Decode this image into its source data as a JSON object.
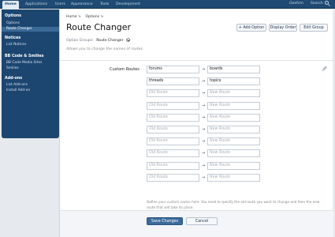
{
  "nav": {
    "tabs": [
      {
        "label": "Home",
        "active": true
      },
      {
        "label": "Applications"
      },
      {
        "label": "Users"
      },
      {
        "label": "Appearance"
      },
      {
        "label": "Tools"
      },
      {
        "label": "Development"
      }
    ],
    "user": "Geefcm",
    "search_label": "Search"
  },
  "sidebar": {
    "sections": [
      {
        "heading": "Options",
        "items": [
          "Options",
          "Route Changer"
        ]
      },
      {
        "heading": "Notices",
        "items": [
          "List Notices"
        ]
      },
      {
        "heading": "BB Code & Smilies",
        "items": [
          "BB Code Media Sites",
          "Smilies"
        ]
      },
      {
        "heading": "Add-ons",
        "items": [
          "List Add-ons",
          "Install Add-on"
        ]
      }
    ],
    "active_item": "Route Changer"
  },
  "breadcrumb": [
    "Home >",
    "Options >"
  ],
  "page_title": "Route Changer",
  "header_buttons": {
    "add_option": "+ Add Option",
    "display_order": "Display Order",
    "edit_group": "Edit Group"
  },
  "option_group": {
    "label": "Option Groups:",
    "value": "Route Changer"
  },
  "description": "Allows you to change the names of routes.",
  "custom_routes": {
    "label": "Custom Routes",
    "old_placeholder": "Old Route",
    "new_placeholder": "New Route",
    "arrow": "→",
    "rows": [
      {
        "old": "forums",
        "new": "boards"
      },
      {
        "old": "threads",
        "new": "topics"
      },
      {
        "old": "",
        "new": ""
      },
      {
        "old": "",
        "new": ""
      },
      {
        "old": "",
        "new": ""
      },
      {
        "old": "",
        "new": ""
      },
      {
        "old": "",
        "new": ""
      },
      {
        "old": "",
        "new": ""
      },
      {
        "old": "",
        "new": ""
      },
      {
        "old": "",
        "new": ""
      }
    ],
    "help": "Define your custom routes here. You need to specify the old route you want to change and then the new route that will take its place."
  },
  "footer": {
    "save": "Save Changes",
    "cancel": "Cancel"
  },
  "colors": {
    "nav_bg": "#1e4a73",
    "sidebar_bg": "#1c4670",
    "primary_button": "#3b6b9b"
  }
}
